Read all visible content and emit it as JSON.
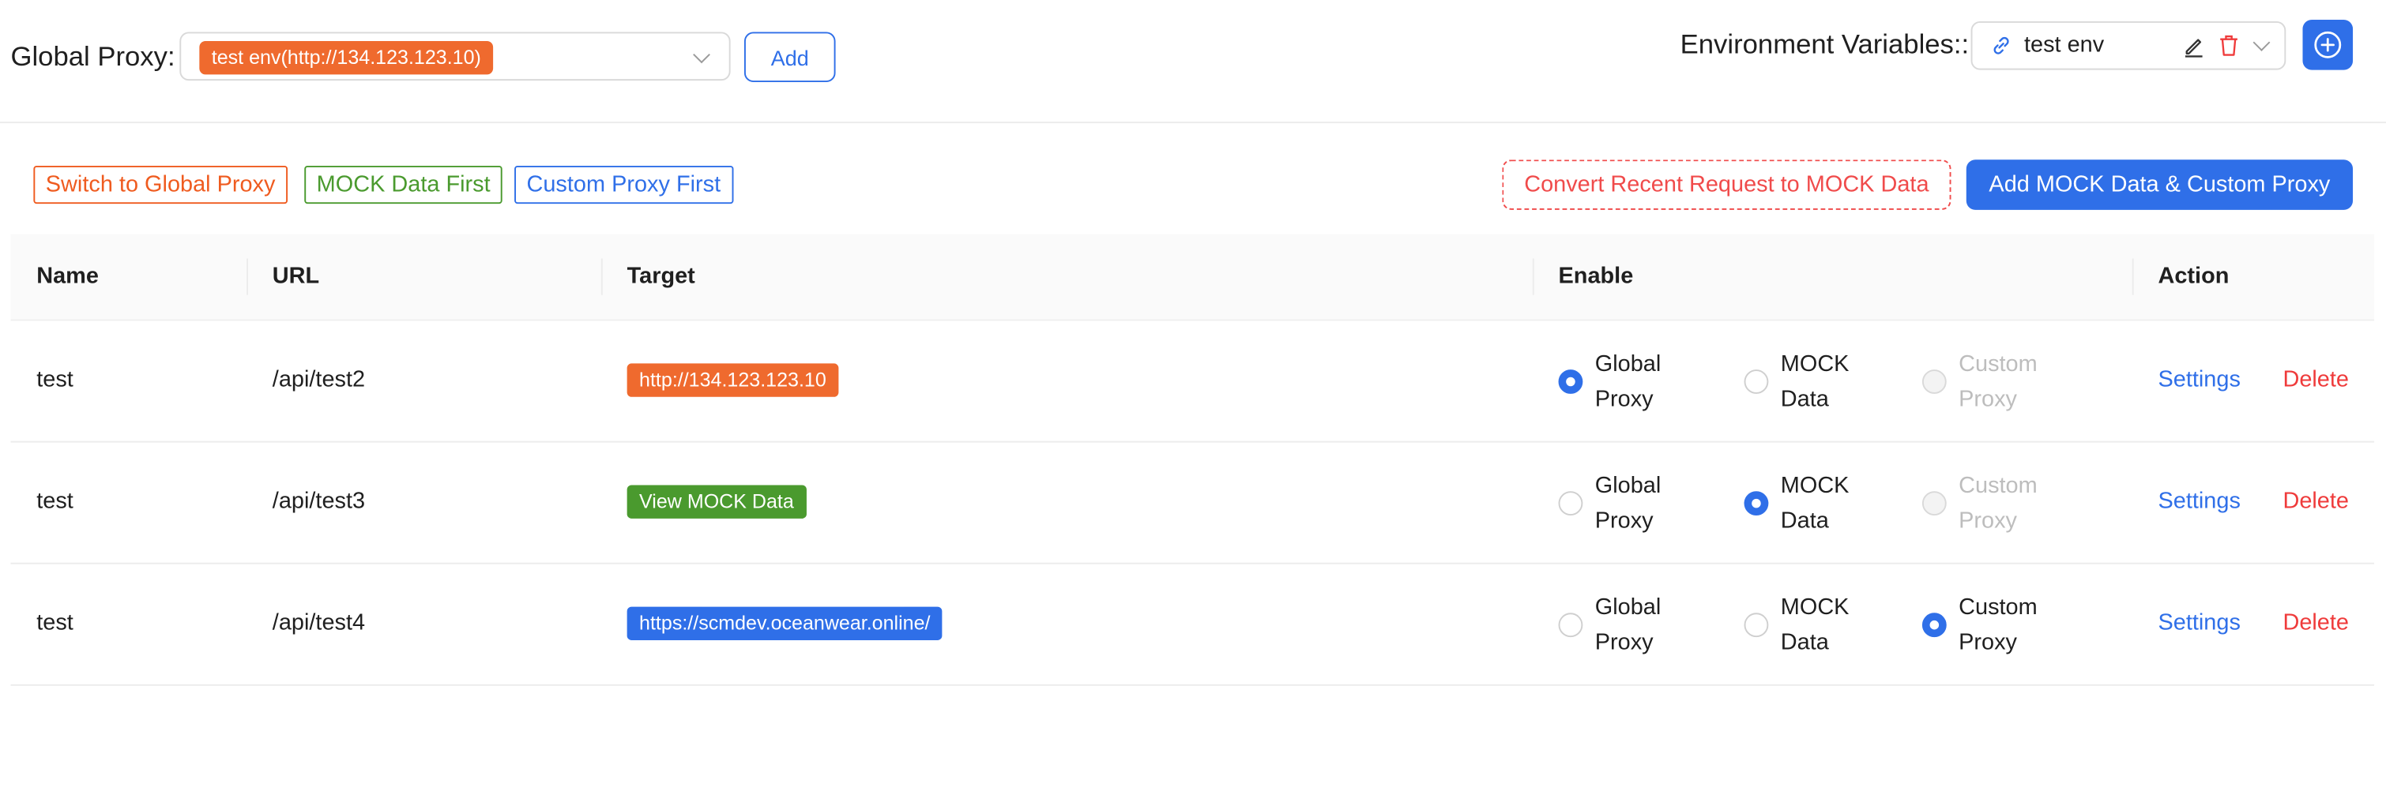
{
  "global_proxy": {
    "label": "Global Proxy:",
    "selected_tag": "test env(http://134.123.123.10)",
    "add_label": "Add"
  },
  "env": {
    "label": "Environment Variables::",
    "selected": "test env"
  },
  "filters": {
    "global": "Switch to Global Proxy",
    "mock": "MOCK Data First",
    "custom": "Custom Proxy First"
  },
  "actions": {
    "convert": "Convert Recent Request to MOCK Data",
    "add_mock": "Add MOCK Data & Custom Proxy"
  },
  "table": {
    "headers": {
      "name": "Name",
      "url": "URL",
      "target": "Target",
      "enable": "Enable",
      "action": "Action"
    },
    "options": {
      "global": [
        "Global",
        "Proxy"
      ],
      "mock": [
        "MOCK",
        "Data"
      ],
      "custom": [
        "Custom",
        "Proxy"
      ]
    },
    "rows": [
      {
        "name": "test",
        "url": "/api/test2",
        "target": "http://134.123.123.10",
        "target_color": "#ef6a2e",
        "selected": "global",
        "custom_disabled": true,
        "settings": "Settings",
        "delete": "Delete"
      },
      {
        "name": "test",
        "url": "/api/test3",
        "target": "View MOCK Data",
        "target_color": "#4a9a2e",
        "selected": "mock",
        "custom_disabled": true,
        "settings": "Settings",
        "delete": "Delete"
      },
      {
        "name": "test",
        "url": "/api/test4",
        "target": "https://scmdev.oceanwear.online/",
        "target_color": "#2f6fe8",
        "selected": "custom",
        "custom_disabled": false,
        "settings": "Settings",
        "delete": "Delete"
      }
    ]
  },
  "colors": {
    "primary": "#2f6fe8",
    "danger": "#ef3b3b",
    "orange": "#ef6a2e",
    "green": "#4a9a2e"
  }
}
